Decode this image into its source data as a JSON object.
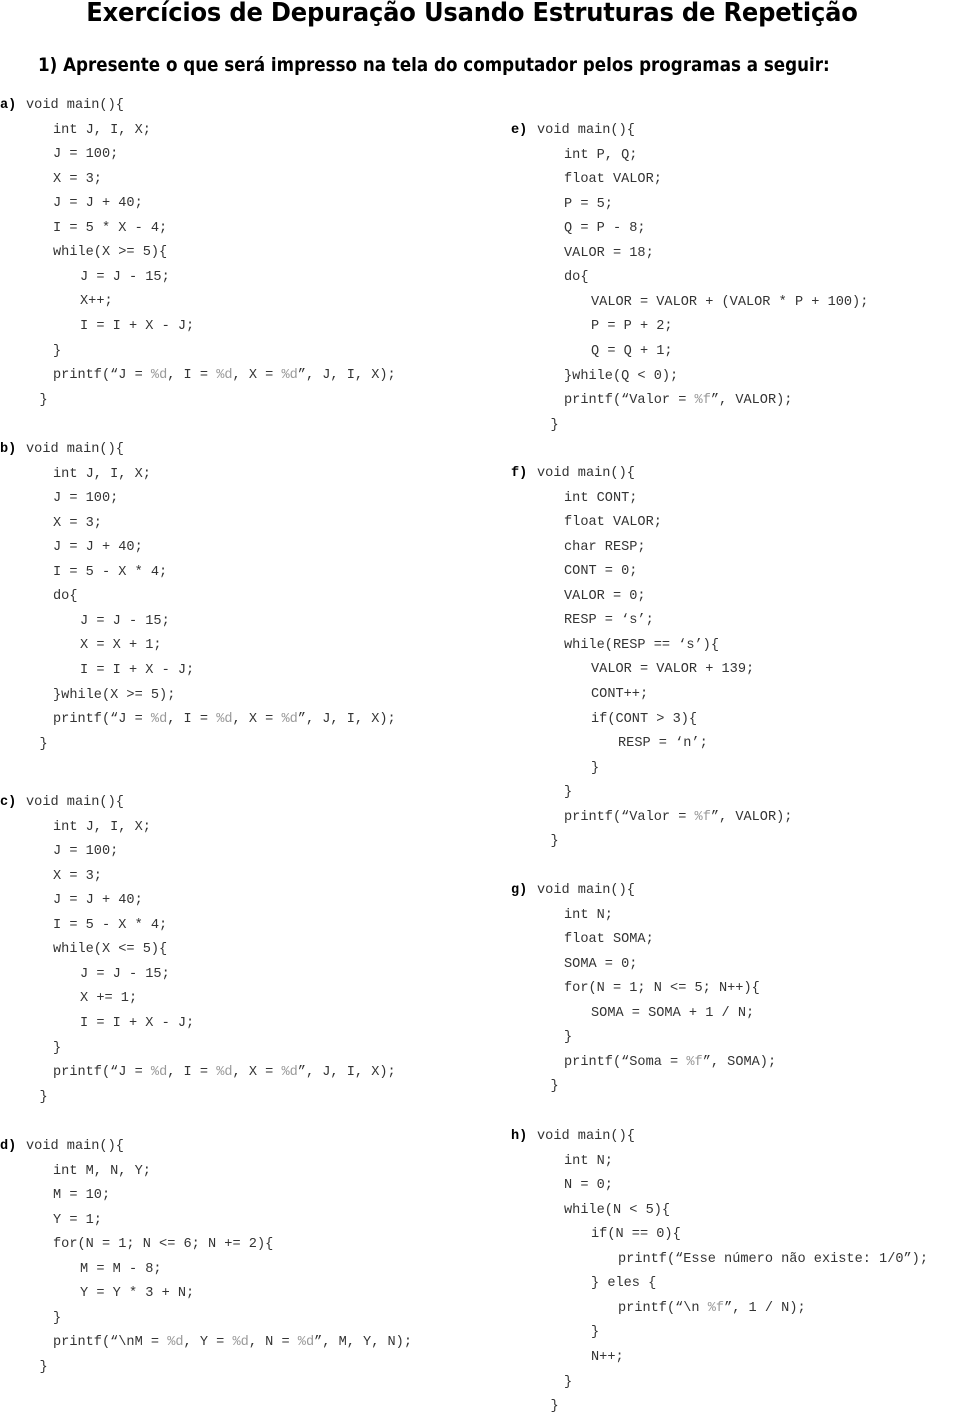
{
  "title": "Exercícios de Depuração Usando Estruturas de Repetição",
  "question": "1)  Apresente o que será impresso na tela do computador pelos programas a seguir:",
  "programs": [
    {
      "id": "a",
      "label": "a)",
      "lines": [
        {
          "indent": 0,
          "text": "void main(){"
        },
        {
          "indent": 1,
          "text": "int J, I, X;"
        },
        {
          "indent": 1,
          "text": "J = 100;"
        },
        {
          "indent": 1,
          "text": "X = 3;"
        },
        {
          "indent": 1,
          "text": "J = J + 40;"
        },
        {
          "indent": 1,
          "text": "I = 5 * X - 4;"
        },
        {
          "indent": 1,
          "text": "while(X >= 5){"
        },
        {
          "indent": 2,
          "text": "J = J - 15;"
        },
        {
          "indent": 2,
          "text": "X++;"
        },
        {
          "indent": 2,
          "text": "I = I + X - J;"
        },
        {
          "indent": 1,
          "text": "}"
        },
        {
          "indent": 1,
          "text": "printf(“J = %d, I = %d, X = %d”, J, I, X);"
        },
        {
          "indent": 0.5,
          "text": "}"
        }
      ]
    },
    {
      "id": "b",
      "label": "b)",
      "lines": [
        {
          "indent": 0,
          "text": "void main(){"
        },
        {
          "indent": 1,
          "text": "int J, I, X;"
        },
        {
          "indent": 1,
          "text": "J = 100;"
        },
        {
          "indent": 1,
          "text": "X = 3;"
        },
        {
          "indent": 1,
          "text": "J = J + 40;"
        },
        {
          "indent": 1,
          "text": "I = 5 - X * 4;"
        },
        {
          "indent": 1,
          "text": "do{"
        },
        {
          "indent": 2,
          "text": "J = J - 15;"
        },
        {
          "indent": 2,
          "text": "X = X + 1;"
        },
        {
          "indent": 2,
          "text": "I = I + X - J;"
        },
        {
          "indent": 1,
          "text": "}while(X >= 5);"
        },
        {
          "indent": 1,
          "text": "printf(“J = %d, I = %d, X = %d”, J, I, X);"
        },
        {
          "indent": 0.5,
          "text": "}"
        }
      ]
    },
    {
      "id": "c",
      "label": "c)",
      "lines": [
        {
          "indent": 0,
          "text": "void main(){"
        },
        {
          "indent": 1,
          "text": "int J, I, X;"
        },
        {
          "indent": 1,
          "text": "J = 100;"
        },
        {
          "indent": 1,
          "text": "X = 3;"
        },
        {
          "indent": 1,
          "text": "J = J + 40;"
        },
        {
          "indent": 1,
          "text": "I = 5 - X * 4;"
        },
        {
          "indent": 1,
          "text": "while(X <= 5){"
        },
        {
          "indent": 2,
          "text": "J = J - 15;"
        },
        {
          "indent": 2,
          "text": "X += 1;"
        },
        {
          "indent": 2,
          "text": "I = I + X - J;"
        },
        {
          "indent": 1,
          "text": "}"
        },
        {
          "indent": 1,
          "text": "printf(“J = %d, I = %d, X = %d”, J, I, X);"
        },
        {
          "indent": 0.5,
          "text": "}"
        }
      ]
    },
    {
      "id": "d",
      "label": "d)",
      "lines": [
        {
          "indent": 0,
          "text": "void main(){"
        },
        {
          "indent": 1,
          "text": "int M, N, Y;"
        },
        {
          "indent": 1,
          "text": "M = 10;"
        },
        {
          "indent": 1,
          "text": "Y = 1;"
        },
        {
          "indent": 1,
          "text": "for(N = 1; N <= 6; N += 2){"
        },
        {
          "indent": 2,
          "text": "M = M - 8;"
        },
        {
          "indent": 2,
          "text": "Y = Y * 3 + N;"
        },
        {
          "indent": 1,
          "text": "}"
        },
        {
          "indent": 1,
          "text": "printf(“\\nM = %d, Y = %d, N = %d”, M, Y, N);"
        },
        {
          "indent": 0.5,
          "text": "}"
        }
      ]
    },
    {
      "id": "e",
      "label": "e)",
      "lines": [
        {
          "indent": 0,
          "text": "void main(){"
        },
        {
          "indent": 1,
          "text": "int P, Q;"
        },
        {
          "indent": 1,
          "text": "float VALOR;"
        },
        {
          "indent": 1,
          "text": "P = 5;"
        },
        {
          "indent": 1,
          "text": "Q = P - 8;"
        },
        {
          "indent": 1,
          "text": "VALOR = 18;"
        },
        {
          "indent": 1,
          "text": "do{"
        },
        {
          "indent": 2,
          "text": "VALOR = VALOR + (VALOR * P + 100);"
        },
        {
          "indent": 2,
          "text": "P = P + 2;"
        },
        {
          "indent": 2,
          "text": "Q = Q + 1;"
        },
        {
          "indent": 1,
          "text": "}while(Q < 0);"
        },
        {
          "indent": 1,
          "text": "printf(“Valor = %f”, VALOR);"
        },
        {
          "indent": 0.5,
          "text": "}"
        }
      ]
    },
    {
      "id": "f",
      "label": "f)",
      "lines": [
        {
          "indent": 0,
          "text": "void main(){"
        },
        {
          "indent": 1,
          "text": "int CONT;"
        },
        {
          "indent": 1,
          "text": "float VALOR;"
        },
        {
          "indent": 1,
          "text": "char RESP;"
        },
        {
          "indent": 1,
          "text": "CONT = 0;"
        },
        {
          "indent": 1,
          "text": "VALOR = 0;"
        },
        {
          "indent": 1,
          "text": "RESP = ‘s’;"
        },
        {
          "indent": 1,
          "text": "while(RESP == ‘s’){"
        },
        {
          "indent": 2,
          "text": "VALOR = VALOR + 139;"
        },
        {
          "indent": 2,
          "text": "CONT++;"
        },
        {
          "indent": 2,
          "text": "if(CONT > 3){"
        },
        {
          "indent": 3,
          "text": "RESP = ‘n’;"
        },
        {
          "indent": 2,
          "text": "}"
        },
        {
          "indent": 1,
          "text": "}"
        },
        {
          "indent": 1,
          "text": "printf(“Valor = %f”, VALOR);"
        },
        {
          "indent": 0.5,
          "text": "}"
        }
      ]
    },
    {
      "id": "g",
      "label": "g)",
      "lines": [
        {
          "indent": 0,
          "text": "void main(){"
        },
        {
          "indent": 1,
          "text": "int N;"
        },
        {
          "indent": 1,
          "text": "float SOMA;"
        },
        {
          "indent": 1,
          "text": "SOMA = 0;"
        },
        {
          "indent": 1,
          "text": "for(N = 1; N <= 5; N++){"
        },
        {
          "indent": 2,
          "text": "SOMA = SOMA + 1 / N;"
        },
        {
          "indent": 1,
          "text": "}"
        },
        {
          "indent": 1,
          "text": "printf(“Soma = %f”, SOMA);"
        },
        {
          "indent": 0.5,
          "text": "}"
        }
      ]
    },
    {
      "id": "h",
      "label": "h)",
      "lines": [
        {
          "indent": 0,
          "text": "void main(){"
        },
        {
          "indent": 1,
          "text": "int N;"
        },
        {
          "indent": 1,
          "text": "N = 0;"
        },
        {
          "indent": 1,
          "text": "while(N < 5){"
        },
        {
          "indent": 2,
          "text": "if(N == 0){"
        },
        {
          "indent": 3,
          "text": "printf(“Esse número não existe: 1/0”);"
        },
        {
          "indent": 2,
          "text": "} eles {"
        },
        {
          "indent": 3,
          "text": "printf(“\\n %f”, 1 / N);"
        },
        {
          "indent": 2,
          "text": "}"
        },
        {
          "indent": 2,
          "text": "N++;"
        },
        {
          "indent": 1,
          "text": "}"
        },
        {
          "indent": 0.5,
          "text": "}"
        }
      ]
    }
  ]
}
